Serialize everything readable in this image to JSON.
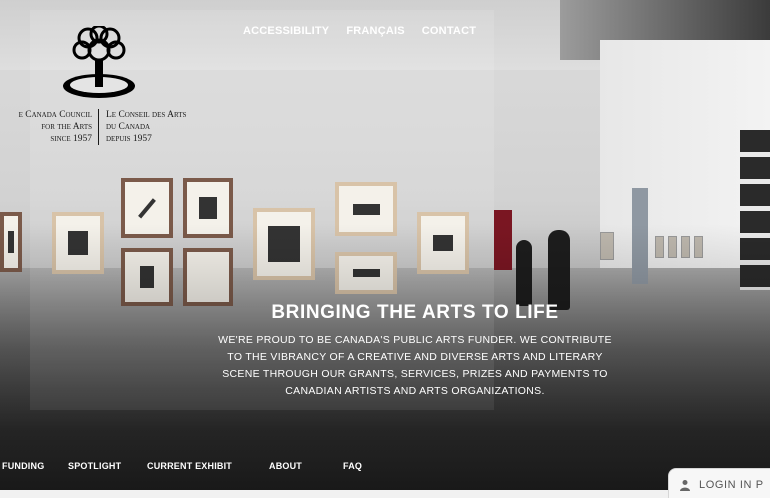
{
  "top_nav": {
    "accessibility": "ACCESSIBILITY",
    "francais": "FRANÇAIS",
    "contact": "CONTACT"
  },
  "logo": {
    "en_line1": "e Canada Council",
    "en_line2": "for the Arts",
    "en_line3": "since 1957",
    "fr_line1": "Le Conseil des Arts",
    "fr_line2": "du Canada",
    "fr_line3": "depuis 1957",
    "icon": "tree-knot-icon"
  },
  "hero": {
    "headline": "BRINGING THE ARTS TO LIFE",
    "intro_lines": [
      "WE'RE PROUD TO BE CANADA'S PUBLIC ARTS FUNDER. WE CONTRIBUTE",
      "TO THE VIBRANCY OF A CREATIVE AND DIVERSE ARTS AND LITERARY",
      "SCENE THROUGH OUR GRANTS, SERVICES, PRIZES AND PAYMENTS TO",
      "CANADIAN ARTISTS AND ARTS ORGANIZATIONS."
    ]
  },
  "bottom_nav": {
    "funding": "FUNDING",
    "spotlight": "SPOTLIGHT",
    "current_exhibit": "CURRENT  EXHIBIT",
    "about": "ABOUT",
    "faq": "FAQ"
  },
  "login": {
    "label": "LOGIN IN P",
    "icon": "user-icon"
  },
  "colors": {
    "nav_text": "#ffffff",
    "logo_text": "#1a1a1a",
    "login_bg": "#f7f7f7"
  }
}
